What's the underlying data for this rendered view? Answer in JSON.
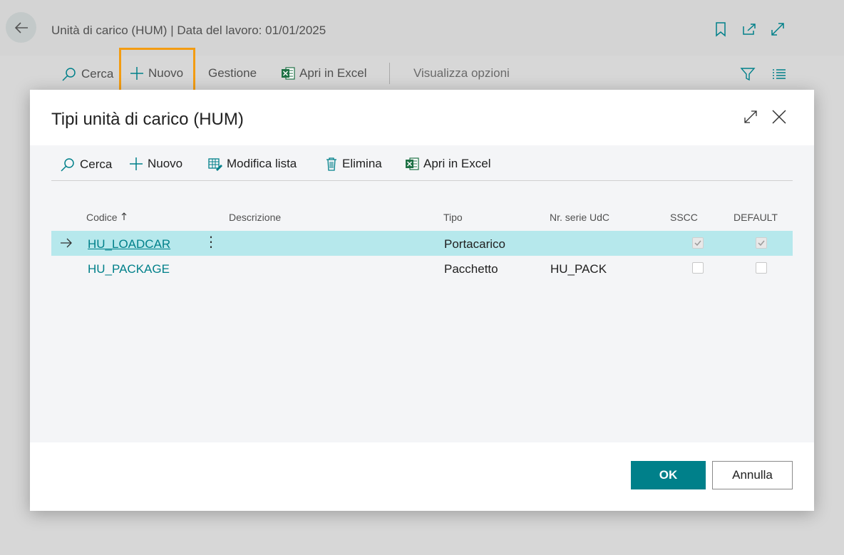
{
  "background": {
    "title": "Unità di carico (HUM) | Data del lavoro: 01/01/2025",
    "actions": {
      "search": "Cerca",
      "new": "Nuovo",
      "manage": "Gestione",
      "excel": "Apri in Excel",
      "view_options": "Visualizza opzioni"
    },
    "icons": [
      "back-arrow-icon",
      "bookmark-icon",
      "share-icon",
      "expand-icon",
      "filter-icon",
      "list-icon"
    ]
  },
  "dialog": {
    "title": "Tipi unità di carico (HUM)",
    "toolbar": {
      "search": "Cerca",
      "new": "Nuovo",
      "edit_list": "Modifica lista",
      "delete": "Elimina",
      "excel": "Apri in Excel"
    },
    "columns": {
      "code": "Codice",
      "description": "Descrizione",
      "type": "Tipo",
      "serial": "Nr. serie UdC",
      "sscc": "SSCC",
      "default": "DEFAULT"
    },
    "rows": [
      {
        "code": "HU_LOADCAR",
        "description": "",
        "type": "Portacarico",
        "serial": "",
        "sscc": true,
        "default": true,
        "selected": true
      },
      {
        "code": "HU_PACKAGE",
        "description": "",
        "type": "Pacchetto",
        "serial": "HU_PACK",
        "sscc": false,
        "default": false,
        "selected": false
      }
    ],
    "buttons": {
      "ok": "OK",
      "cancel": "Annulla"
    }
  },
  "colors": {
    "accent": "#00808a",
    "selected_row": "#b6e8ec",
    "highlight": "#f39c12",
    "excel_green": "#1e7145"
  }
}
